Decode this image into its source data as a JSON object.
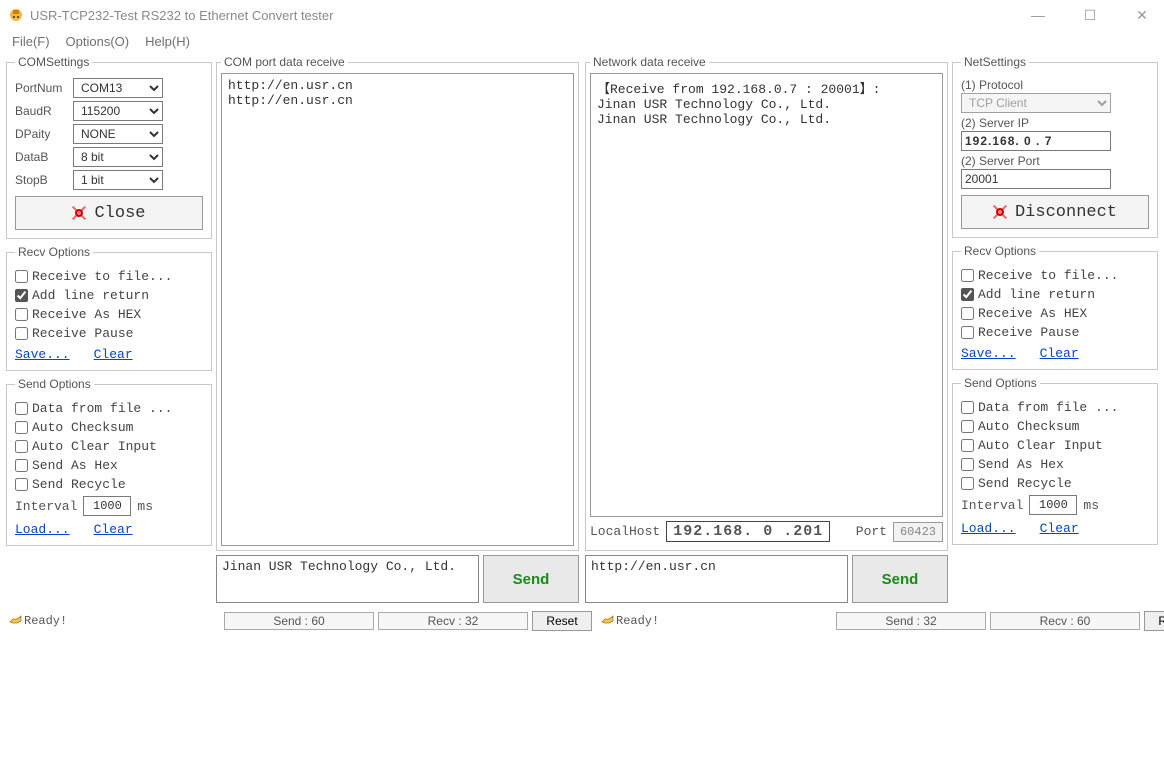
{
  "window": {
    "title": "USR-TCP232-Test  RS232 to Ethernet Convert tester"
  },
  "menu": {
    "file": "File(F)",
    "options": "Options(O)",
    "help": "Help(H)"
  },
  "com_settings": {
    "legend": "COMSettings",
    "portnum_label": "PortNum",
    "portnum": "COM13",
    "baud_label": "BaudR",
    "baud": "115200",
    "parity_label": "DPaity",
    "parity": "NONE",
    "datab_label": "DataB",
    "datab": "8 bit",
    "stopb_label": "StopB",
    "stopb": "1 bit",
    "close_btn": "Close"
  },
  "net_settings": {
    "legend": "NetSettings",
    "proto_label": "(1) Protocol",
    "proto": "TCP Client",
    "ip_label": "(2) Server IP",
    "ip": "192.168. 0 . 7",
    "port_label": "(2) Server Port",
    "port": "20001",
    "disconnect_btn": "Disconnect"
  },
  "recv_opts": {
    "legend": "Recv Options",
    "to_file": "Receive to file...",
    "add_line": "Add line return",
    "as_hex": "Receive As HEX",
    "pause": "Receive Pause",
    "save": "Save...",
    "clear": "Clear"
  },
  "send_opts": {
    "legend": "Send Options",
    "from_file": "Data from file ...",
    "auto_cksum": "Auto Checksum",
    "auto_clear": "Auto Clear Input",
    "as_hex": "Send As Hex",
    "recycle": "Send Recycle",
    "interval_label": "Interval",
    "interval_val": "1000",
    "interval_unit": "ms",
    "load": "Load...",
    "clear": "Clear"
  },
  "com_panel": {
    "legend": "COM port data receive",
    "received": "http://en.usr.cn\nhttp://en.usr.cn",
    "send_text": "Jinan USR Technology Co., Ltd.",
    "send_btn": "Send"
  },
  "net_panel": {
    "legend": "Network data receive",
    "received": "【Receive from 192.168.0.7 : 20001】:\nJinan USR Technology Co., Ltd.\nJinan USR Technology Co., Ltd.",
    "localhost_label": "LocalHost",
    "localhost_ip": "192.168. 0 .201",
    "port_label": "Port",
    "port_val": "60423",
    "send_text": "http://en.usr.cn",
    "send_btn": "Send"
  },
  "status": {
    "ready": "Ready!",
    "com_send": "Send : 60",
    "com_recv": "Recv : 32",
    "net_send": "Send : 32",
    "net_recv": "Recv : 60",
    "reset": "Reset"
  }
}
